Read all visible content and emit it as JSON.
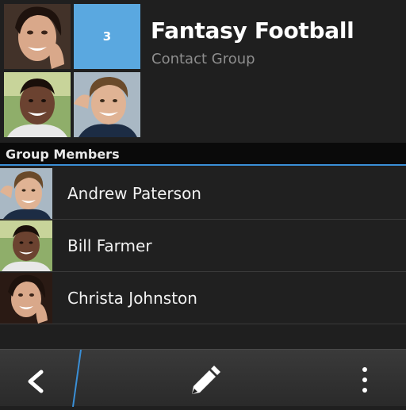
{
  "group": {
    "member_count": "3",
    "title": "Fantasy Football",
    "subtitle": "Contact Group"
  },
  "section": {
    "title": "Group Members"
  },
  "members": [
    {
      "name": "Andrew Paterson",
      "avatar": "andrew-paterson-avatar"
    },
    {
      "name": "Bill Farmer",
      "avatar": "bill-farmer-avatar"
    },
    {
      "name": "Christa Johnston",
      "avatar": "christa-johnston-avatar"
    }
  ],
  "action_bar": {
    "back": "chevron-left-icon",
    "edit": "pencil-icon",
    "menu": "overflow-menu-icon"
  },
  "colors": {
    "accent": "#3a8fd6",
    "count_tile": "#5aa8e0",
    "background": "#1f1f1f",
    "subtitle": "#8e8e8e"
  }
}
